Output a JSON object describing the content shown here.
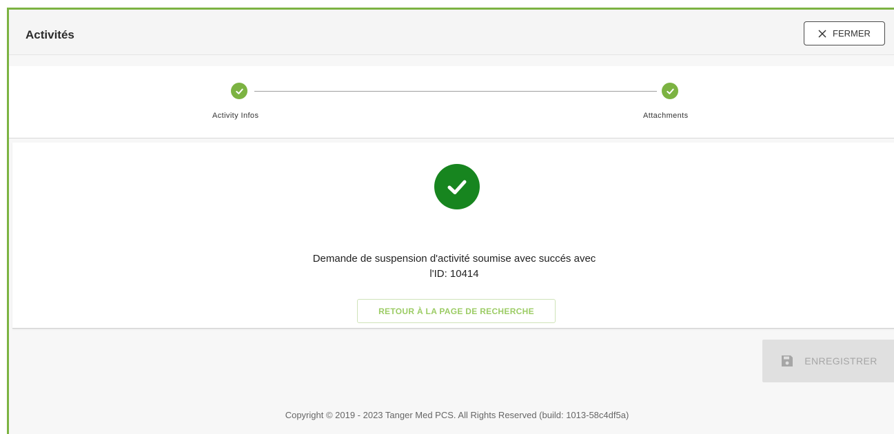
{
  "header": {
    "title": "Activités",
    "close_label": "FERMER"
  },
  "stepper": {
    "steps": [
      {
        "label": "Activity Infos",
        "status": "complete"
      },
      {
        "label": "Attachments",
        "status": "complete"
      }
    ]
  },
  "result": {
    "message_line1": "Demande de suspension d'activité soumise avec succés avec",
    "message_line2": "l'ID: 10414",
    "back_label": "RETOUR À LA PAGE DE RECHERCHE"
  },
  "actions": {
    "save_label": "ENREGISTRER",
    "save_enabled": false
  },
  "footer": {
    "copyright": "Copyright © 2019 - 2023 Tanger Med PCS. All Rights Reserved (build: 1013-58c4df5a)"
  },
  "colors": {
    "accent": "#7cb342",
    "success": "#17851f",
    "back_button_text": "#9ccc65",
    "disabled_bg": "#e0e0e0"
  }
}
